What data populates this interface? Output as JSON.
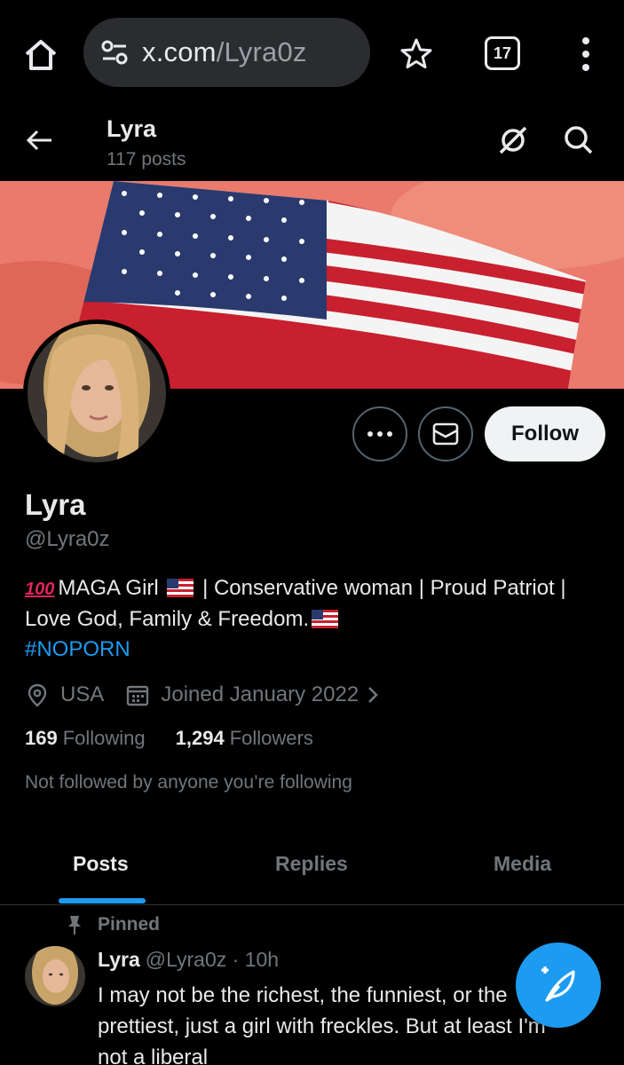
{
  "browser": {
    "url_domain": "x.com",
    "url_path": "/Lyra0z",
    "tab_count": "17"
  },
  "header": {
    "name": "Lyra",
    "post_count": "117 posts"
  },
  "profile": {
    "display_name": "Lyra",
    "handle": "@Lyra0z",
    "follow_label": "Follow",
    "bio_line1": "MAGA Girl",
    "bio_line1_rest": "| Conservative woman | Proud Patriot |",
    "bio_line2": "Love God, Family & Freedom.",
    "hashtag": "#NOPORN",
    "location": "USA",
    "joined": "Joined January 2022",
    "following_count": "169",
    "following_label": "Following",
    "followers_count": "1,294",
    "followers_label": "Followers",
    "not_followed": "Not followed by anyone you’re following"
  },
  "tabs": [
    {
      "label": "Posts",
      "active": true
    },
    {
      "label": "Replies",
      "active": false
    },
    {
      "label": "Media",
      "active": false
    }
  ],
  "pinned_post": {
    "pinned_label": "Pinned",
    "author_name": "Lyra",
    "author_handle": "@Lyra0z",
    "time": "· 10h",
    "text_line1": "I may not be the richest, the funniest, or the",
    "text_line2": "prettiest, just a girl with freckles. But at least I'm",
    "text_line3": "not a liberal"
  },
  "colors": {
    "accent": "#1d9bf0",
    "background": "#000000",
    "secondary_text": "#71767b"
  }
}
